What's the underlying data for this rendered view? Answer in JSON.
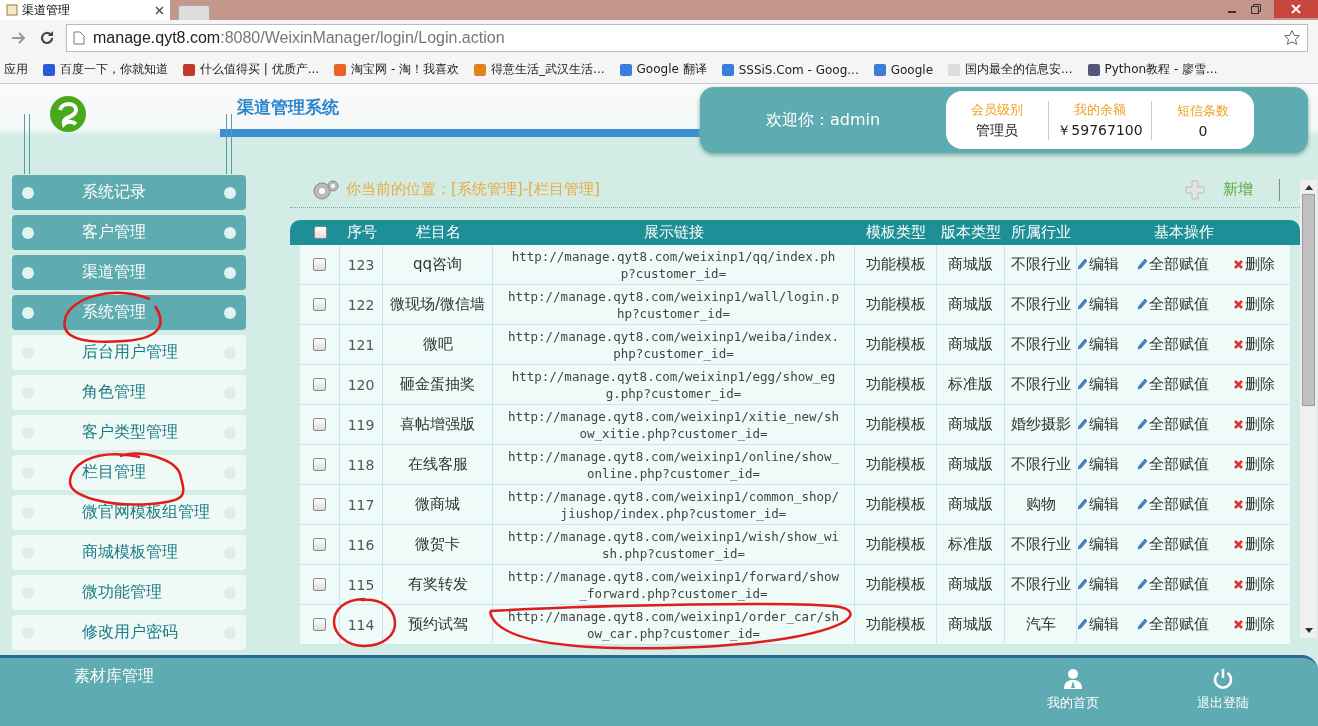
{
  "browser": {
    "tab_title": "渠道管理",
    "url_host": "manage.qyt8.com",
    "url_rest": ":8080/WeixinManager/login/Login.action",
    "bookmarks": [
      "应用",
      "百度一下，你就知道",
      "什么值得买 | 优质产...",
      "淘宝网 - 淘！我喜欢",
      "得意生活_武汉生活...",
      "Google 翻译",
      "SSSiS.Com - Goog...",
      "Google",
      "国内最全的信息安...",
      "Python教程 - 廖雪..."
    ]
  },
  "header": {
    "system_title": "渠道管理系统",
    "welcome": "欢迎你：admin",
    "stats": [
      {
        "label": "会员级别",
        "value": "管理员"
      },
      {
        "label": "我的余额",
        "value": "￥59767100"
      },
      {
        "label": "短信条数",
        "value": "0"
      }
    ]
  },
  "sidebar": {
    "items": [
      {
        "label": "系统记录",
        "kind": "main"
      },
      {
        "label": "客户管理",
        "kind": "main"
      },
      {
        "label": "渠道管理",
        "kind": "main"
      },
      {
        "label": "系统管理",
        "kind": "main"
      },
      {
        "label": "后台用户管理",
        "kind": "sub"
      },
      {
        "label": "角色管理",
        "kind": "sub"
      },
      {
        "label": "客户类型管理",
        "kind": "sub"
      },
      {
        "label": "栏目管理",
        "kind": "sub"
      },
      {
        "label": "微官网模板组管理",
        "kind": "sub"
      },
      {
        "label": "商城模板管理",
        "kind": "sub"
      },
      {
        "label": "微功能管理",
        "kind": "sub"
      },
      {
        "label": "修改用户密码",
        "kind": "sub"
      }
    ]
  },
  "breadcrumb": "你当前的位置：[系统管理]-[栏目管理]",
  "add_button": "新增",
  "table": {
    "select_all_checked": false,
    "columns": [
      "序号",
      "栏目名",
      "展示链接",
      "模板类型",
      "版本类型",
      "所属行业",
      "基本操作"
    ],
    "rows": [
      {
        "checked": false,
        "id": "123",
        "name": "qq咨询",
        "link": "http://manage.qyt8.com/weixinp1/qq/index.php?customer_id=",
        "template": "功能模板",
        "version": "商城版",
        "industry": "不限行业",
        "actions": [
          "编辑",
          "全部赋值",
          "删除"
        ]
      },
      {
        "checked": false,
        "id": "122",
        "name": "微现场/微信墙",
        "link": "http://manage.qyt8.com/weixinp1/wall/login.php?customer_id=",
        "template": "功能模板",
        "version": "商城版",
        "industry": "不限行业",
        "actions": [
          "编辑",
          "全部赋值",
          "删除"
        ]
      },
      {
        "checked": false,
        "id": "121",
        "name": "微吧",
        "link": "http://manage.qyt8.com/weixinp1/weiba/index.php?customer_id=",
        "template": "功能模板",
        "version": "商城版",
        "industry": "不限行业",
        "actions": [
          "编辑",
          "全部赋值",
          "删除"
        ]
      },
      {
        "checked": false,
        "id": "120",
        "name": "砸金蛋抽奖",
        "link": "http://manage.qyt8.com/weixinp1/egg/show_egg.php?customer_id=",
        "template": "功能模板",
        "version": "标准版",
        "industry": "不限行业",
        "actions": [
          "编辑",
          "全部赋值",
          "删除"
        ]
      },
      {
        "checked": false,
        "id": "119",
        "name": "喜帖增强版",
        "link": "http://manage.qyt8.com/weixinp1/xitie_new/show_xitie.php?customer_id=",
        "template": "功能模板",
        "version": "商城版",
        "industry": "婚纱摄影",
        "actions": [
          "编辑",
          "全部赋值",
          "删除"
        ]
      },
      {
        "checked": false,
        "id": "118",
        "name": "在线客服",
        "link": "http://manage.qyt8.com/weixinp1/online/show_online.php?customer_id=",
        "template": "功能模板",
        "version": "商城版",
        "industry": "不限行业",
        "actions": [
          "编辑",
          "全部赋值",
          "删除"
        ]
      },
      {
        "checked": false,
        "id": "117",
        "name": "微商城",
        "link": "http://manage.qyt8.com/weixinp1/common_shop/jiushop/index.php?customer_id=",
        "template": "功能模板",
        "version": "商城版",
        "industry": "购物",
        "actions": [
          "编辑",
          "全部赋值",
          "删除"
        ]
      },
      {
        "checked": false,
        "id": "116",
        "name": "微贺卡",
        "link": "http://manage.qyt8.com/weixinp1/wish/show_wish.php?customer_id=",
        "template": "功能模板",
        "version": "标准版",
        "industry": "不限行业",
        "actions": [
          "编辑",
          "全部赋值",
          "删除"
        ]
      },
      {
        "checked": false,
        "id": "115",
        "name": "有奖转发",
        "link": "http://manage.qyt8.com/weixinp1/forward/show_forward.php?customer_id=",
        "template": "功能模板",
        "version": "商城版",
        "industry": "不限行业",
        "actions": [
          "编辑",
          "全部赋值",
          "删除"
        ]
      },
      {
        "checked": false,
        "id": "114",
        "name": "预约试驾",
        "link": "http://manage.qyt8.com/weixinp1/order_car/show_car.php?customer_id=",
        "template": "功能模板",
        "version": "商城版",
        "industry": "汽车",
        "actions": [
          "编辑",
          "全部赋值",
          "删除"
        ]
      }
    ]
  },
  "footer": {
    "section": "素材库管理",
    "buttons": [
      {
        "label": "我的首页",
        "kind": "home"
      },
      {
        "label": "退出登陆",
        "kind": "logout"
      }
    ]
  }
}
